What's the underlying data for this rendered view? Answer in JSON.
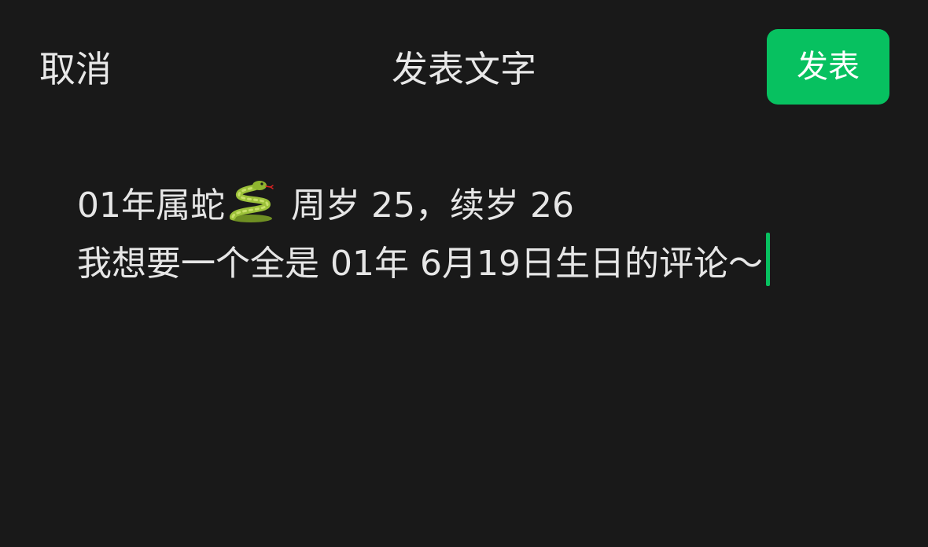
{
  "header": {
    "cancel_label": "取消",
    "title": "发表文字",
    "publish_label": "发表"
  },
  "editor": {
    "line1_prefix": "01年属蛇",
    "line1_emoji": "snake-icon",
    "line1_suffix": " 周岁 25，续岁 26",
    "line2": "我想要一个全是 01年 6月19日生日的评论～"
  },
  "colors": {
    "background": "#191919",
    "text": "#e6e6e6",
    "accent": "#07c160"
  }
}
